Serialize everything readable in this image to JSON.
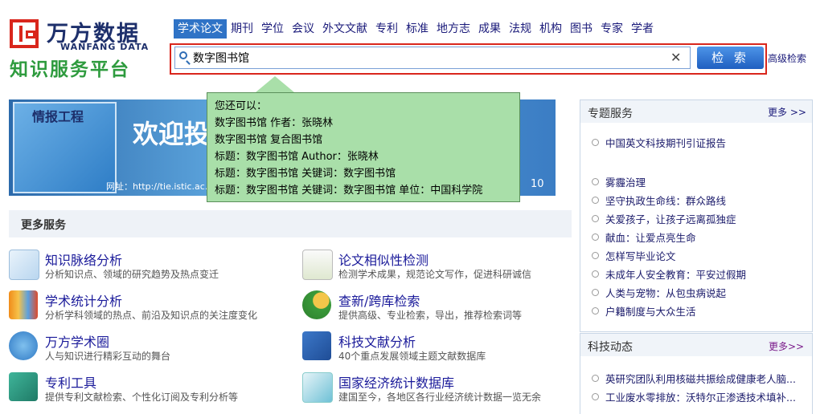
{
  "logo": {
    "cn": "万方数据",
    "en": "WANFANG DATA",
    "sub": "知识服务平台"
  },
  "nav": [
    "学术论文",
    "期刊",
    "学位",
    "会议",
    "外文文献",
    "专利",
    "标准",
    "地方志",
    "成果",
    "法规",
    "机构",
    "图书",
    "专家",
    "学者"
  ],
  "search": {
    "value": "数字图书馆",
    "button": "检 索",
    "advanced": "高级检索",
    "clear": "✕"
  },
  "banner": {
    "mag_title": "情报工程",
    "title": "欢迎投",
    "url": "网址：http://tie.istic.ac.cn",
    "num": "10"
  },
  "tooltip": {
    "lines": [
      "您还可以：",
      "数字图书馆  作者：张晓林",
      "数字图书馆  复合图书馆",
      "标题：数字图书馆  Author：张晓林",
      "标题：数字图书馆  关键词：数字图书馆",
      "标题：数字图书馆  关键词：数字图书馆  单位：中国科学院"
    ]
  },
  "more_services": {
    "title": "更多服务",
    "items": [
      {
        "title": "知识脉络分析",
        "desc": "分析知识点、领域的研究趋势及热点变迁",
        "icon": "chart-line-icon"
      },
      {
        "title": "论文相似性检测",
        "desc": "检测学术成果，规范论文写作，促进科研诚信",
        "icon": "document-icon"
      },
      {
        "title": "学术统计分析",
        "desc": "分析学科领域的热点、前沿及知识点的关注度变化",
        "icon": "bar-chart-icon"
      },
      {
        "title": "查新/跨库检索",
        "desc": "提供高级、专业检索，导出，推荐检索词等",
        "icon": "search-person-icon"
      },
      {
        "title": "万方学术圈",
        "desc": "人与知识进行精彩互动的舞台",
        "icon": "globe-people-icon"
      },
      {
        "title": "科技文献分析",
        "desc": "40个重点发展领域主题文献数据库",
        "icon": "folder-star-icon"
      },
      {
        "title": "专利工具",
        "desc": "提供专利文献检索、个性化订阅及专利分析等",
        "icon": "book-icon"
      },
      {
        "title": "国家经济统计数据库",
        "desc": "建国至今，各地区各行业经济统计数据一览无余",
        "icon": "cube-icon"
      }
    ]
  },
  "special": {
    "title": "专题服务",
    "more": "更多 >>",
    "top_item": "中国英文科技期刊引证报告",
    "items": [
      "雾霾治理",
      "坚守执政生命线：群众路线",
      "关爱孩子，让孩子远离孤独症",
      "献血：让爱点亮生命",
      "怎样写毕业论文",
      "未成年人安全教育：平安过假期",
      "人类与宠物：从包虫病说起",
      "户籍制度与大众生活"
    ]
  },
  "news": {
    "title": "科技动态",
    "more": "更多>>",
    "items": [
      "英研究团队利用核磁共振绘成健康老人脑...",
      "工业废水零排放：沃特尔正渗透技术填补..."
    ]
  },
  "colors": {
    "brand_blue": "#1d2f6b",
    "brand_red": "#d9261c",
    "brand_green": "#2e9b3e",
    "link": "#1a1a9a"
  }
}
